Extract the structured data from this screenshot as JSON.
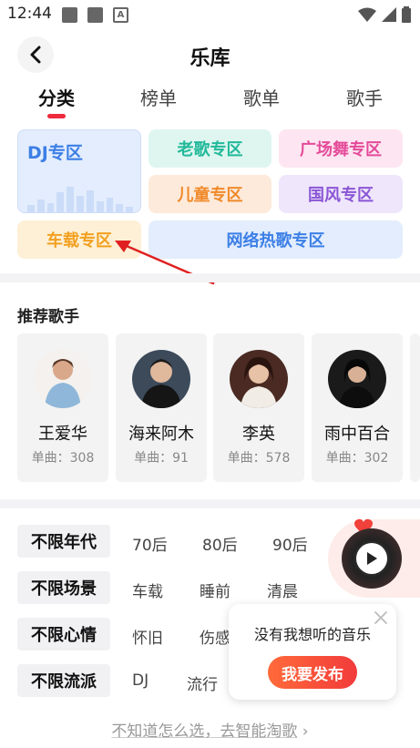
{
  "status": {
    "time": "12:44"
  },
  "header": {
    "title": "乐库"
  },
  "tabs": [
    {
      "label": "分类"
    },
    {
      "label": "榜单"
    },
    {
      "label": "歌单"
    },
    {
      "label": "歌手"
    }
  ],
  "categories": {
    "dj": "DJ专区",
    "laoge": "老歌专区",
    "guangchangwu": "广场舞专区",
    "ertong": "儿童专区",
    "guofeng": "国风专区",
    "chezai": "车载专区",
    "wangluo": "网络热歌专区"
  },
  "colors": {
    "accent": "#ee2a3c",
    "dj": "#3c7fe6",
    "laoge": "#22b99a",
    "guangchangwu": "#e44b9a",
    "ertong": "#f08a2a",
    "guofeng": "#8a56d6",
    "chezai": "#f2a020",
    "wangluo": "#3c7fe6",
    "annotation_arrow": "#e02020"
  },
  "singers": {
    "title": "推荐歌手",
    "items": [
      {
        "name": "王爱华",
        "count": "单曲：308"
      },
      {
        "name": "海来阿木",
        "count": "单曲：91"
      },
      {
        "name": "李英",
        "count": "单曲：578"
      },
      {
        "name": "雨中百合",
        "count": "单曲：302"
      }
    ]
  },
  "filters": {
    "era": {
      "label": "不限年代",
      "options": [
        "70后",
        "80后",
        "90后"
      ]
    },
    "scene": {
      "label": "不限场景",
      "options": [
        "车载",
        "睡前",
        "清晨"
      ]
    },
    "mood": {
      "label": "不限心情",
      "options": [
        "怀旧",
        "伤感"
      ]
    },
    "genre": {
      "label": "不限流派",
      "options": [
        "DJ",
        "流行"
      ]
    }
  },
  "popup": {
    "text": "没有我想听的音乐",
    "button": "我要发布"
  },
  "bottom": {
    "link": "不知道怎么选，去智能淘歌",
    "chevron": "›"
  }
}
